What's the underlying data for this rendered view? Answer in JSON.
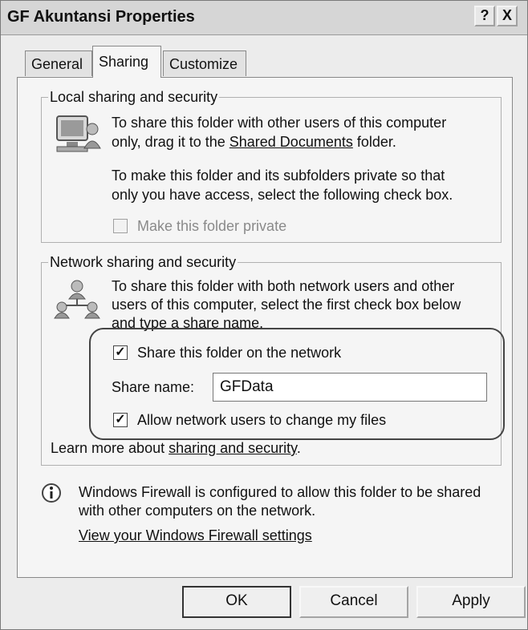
{
  "window": {
    "title": "GF Akuntansi Properties",
    "help_button": "?",
    "close_button": "X"
  },
  "tabs": [
    {
      "label": "General",
      "selected": false
    },
    {
      "label": "Sharing",
      "selected": true
    },
    {
      "label": "Customize",
      "selected": false
    }
  ],
  "local_group": {
    "legend": "Local sharing and security",
    "text1_part1": "To share this folder with other users of this computer",
    "text1_part2_prefix": "only, drag it to the ",
    "text1_link": "Shared Documents",
    "text1_part2_suffix": " folder.",
    "text2_line1": "To make this folder and its subfolders private so that",
    "text2_line2": "only you have access, select the following check box.",
    "private_checkbox_label": "Make this folder private",
    "private_checked": false
  },
  "network_group": {
    "legend": "Network sharing and security",
    "text_line1": "To share this folder with both network users and other",
    "text_line2": "users of this computer, select the first check box below",
    "text_line3": "and type a share name.",
    "share_checkbox_label": "Share this folder on the network",
    "share_checked": true,
    "share_name_label": "Share name:",
    "share_name_value": "GFData",
    "allow_change_label": "Allow network users to change my files",
    "allow_checked": true,
    "learn_more_prefix": "Learn more about ",
    "learn_more_link": "sharing and security",
    "learn_more_suffix": "."
  },
  "firewall": {
    "line1": "Windows Firewall is configured to allow this folder to be shared",
    "line2": "with other computers on the network.",
    "link": "View your Windows Firewall settings"
  },
  "buttons": {
    "ok": "OK",
    "cancel": "Cancel",
    "apply": "Apply"
  }
}
